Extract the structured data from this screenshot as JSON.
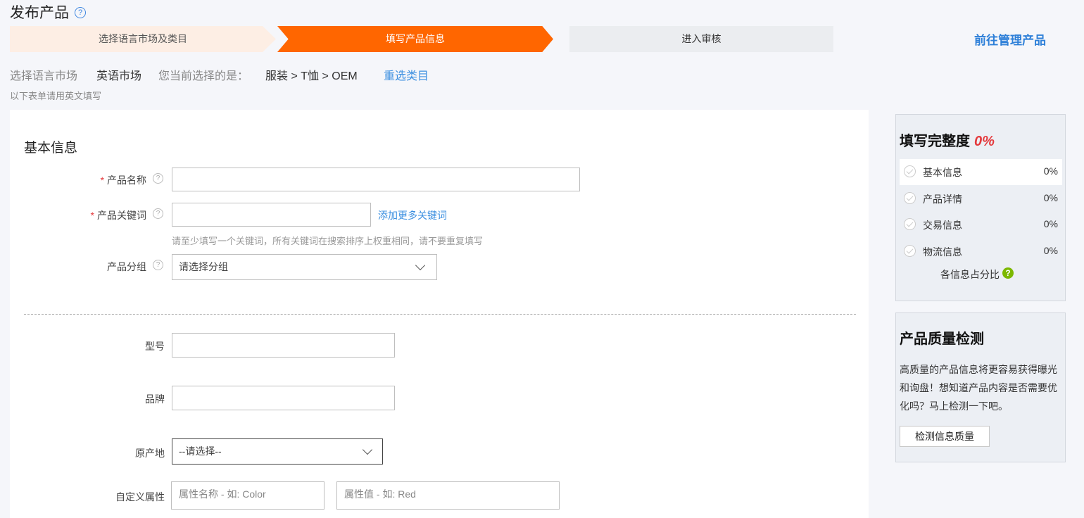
{
  "page": {
    "title": "发布产品"
  },
  "steps": [
    "选择语言市场及类目",
    "填写产品信息",
    "进入审核"
  ],
  "manage_link": "前往管理产品",
  "breadcrumb": {
    "market_label": "选择语言市场",
    "market_value": "英语市场",
    "current_label": "您当前选择的是：",
    "category_path": "服装 > T恤 > OEM",
    "reselect": "重选类目"
  },
  "note": "以下表单请用英文填写",
  "colors": {
    "accent": "#ff6600",
    "link": "#3b8fe0",
    "required": "#e4393c",
    "ok": "#7cb800"
  },
  "form": {
    "section_title": "基本信息",
    "product_name": {
      "label": "产品名称",
      "value": ""
    },
    "keywords": {
      "label": "产品关键词",
      "value": "",
      "add_more": "添加更多关键词",
      "hint": "请至少填写一个关键词，所有关键词在搜索排序上权重相同，请不要重复填写"
    },
    "group": {
      "label": "产品分组",
      "selected": "请选择分组"
    },
    "model": {
      "label": "型号",
      "value": ""
    },
    "brand": {
      "label": "品牌",
      "value": ""
    },
    "origin": {
      "label": "原产地",
      "selected": "--请选择--"
    },
    "custom_attr": {
      "label": "自定义属性",
      "name_placeholder": "属性名称 - 如: Color",
      "value_placeholder": "属性值 - 如: Red"
    }
  },
  "completeness": {
    "title": "填写完整度",
    "percent": "0%",
    "items": [
      {
        "label": "基本信息",
        "value": "0%"
      },
      {
        "label": "产品详情",
        "value": "0%"
      },
      {
        "label": "交易信息",
        "value": "0%"
      },
      {
        "label": "物流信息",
        "value": "0%"
      }
    ],
    "ratio_label": "各信息占分比"
  },
  "quality": {
    "title": "产品质量检测",
    "description": "高质量的产品信息将更容易获得曝光和询盘！想知道产品内容是否需要优化吗？马上检测一下吧。",
    "button": "检测信息质量"
  }
}
